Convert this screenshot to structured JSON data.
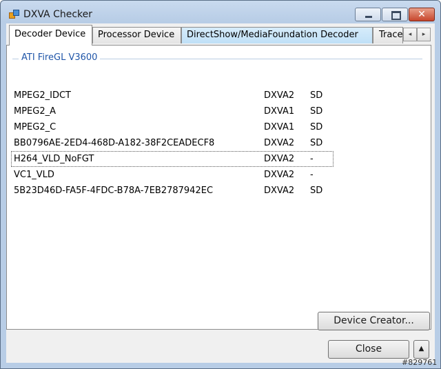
{
  "window": {
    "title": "DXVA Checker",
    "caption_buttons": {
      "minimize": "_",
      "maximize": "□",
      "close": "✕"
    }
  },
  "tabs": [
    {
      "label": "Decoder Device",
      "active": true
    },
    {
      "label": "Processor Device",
      "active": false
    },
    {
      "label": "DirectShow/MediaFoundation Decoder",
      "active": false
    },
    {
      "label": "Trace",
      "active": false
    }
  ],
  "tab_scroll": {
    "left": "◂",
    "right": "▸"
  },
  "device_group": {
    "label": "ATI FireGL V3600"
  },
  "decoders": [
    {
      "name": "MPEG2_IDCT",
      "api": "DXVA2",
      "res": "SD"
    },
    {
      "name": "MPEG2_A",
      "api": "DXVA1",
      "res": "SD"
    },
    {
      "name": "MPEG2_C",
      "api": "DXVA1",
      "res": "SD"
    },
    {
      "name": "BB0796AE-2ED4-468D-A182-38F2CEADECF8",
      "api": "DXVA2",
      "res": "SD"
    },
    {
      "name": "H264_VLD_NoFGT",
      "api": "DXVA2",
      "res": "-"
    },
    {
      "name": "VC1_VLD",
      "api": "DXVA2",
      "res": "-"
    },
    {
      "name": "5B23D46D-FA5F-4FDC-B78A-7EB2787942EC",
      "api": "DXVA2",
      "res": "SD"
    }
  ],
  "buttons": {
    "device_creator": "Device Creator...",
    "close": "Close",
    "up": "▲"
  },
  "watermark": "#829761"
}
